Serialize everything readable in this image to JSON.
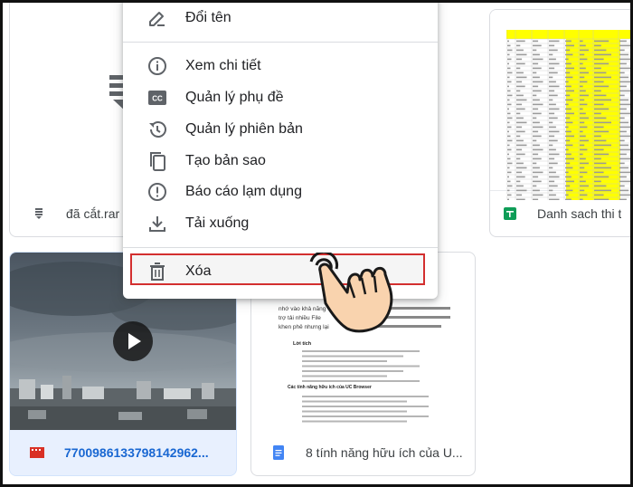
{
  "menu": {
    "items": [
      {
        "label": "Đổi tên",
        "icon": "pencil-icon"
      },
      {
        "label": "Xem chi tiết",
        "icon": "info-icon"
      },
      {
        "label": "Quản lý phụ đề",
        "icon": "closed-caption-icon"
      },
      {
        "label": "Quản lý phiên bản",
        "icon": "history-icon"
      },
      {
        "label": "Tạo bản sao",
        "icon": "copy-icon"
      },
      {
        "label": "Báo cáo lạm dụng",
        "icon": "report-icon"
      },
      {
        "label": "Tải xuống",
        "icon": "download-icon"
      },
      {
        "label": "Xóa",
        "icon": "trash-icon"
      }
    ]
  },
  "files": {
    "archive": {
      "name": "đã cắt.rar",
      "icon": "archive-file-icon"
    },
    "sheet": {
      "name": "Danh sach thi t",
      "icon": "google-sheets-icon",
      "icon_color": "#0f9d58"
    },
    "video": {
      "name": "770098613379814296​2...",
      "icon": "video-file-icon",
      "icon_color": "#d93025"
    },
    "doc": {
      "name": "8 tính năng hữu ích của U...",
      "icon": "google-docs-icon",
      "icon_color": "#4285f4"
    }
  },
  "doc_preview": {
    "lines": [
      "nhớ vào khả năng",
      "trợ tải nhiều File",
      "khen phê nhưng lại",
      "Lời tích",
      "Các tính năng hữu ích của UC Browser"
    ]
  },
  "colors": {
    "highlight_border": "#d32f2f",
    "sheet_highlight": "#ffff00",
    "selected_card_bg": "#e8f0fe",
    "link_blue": "#1967d2"
  }
}
